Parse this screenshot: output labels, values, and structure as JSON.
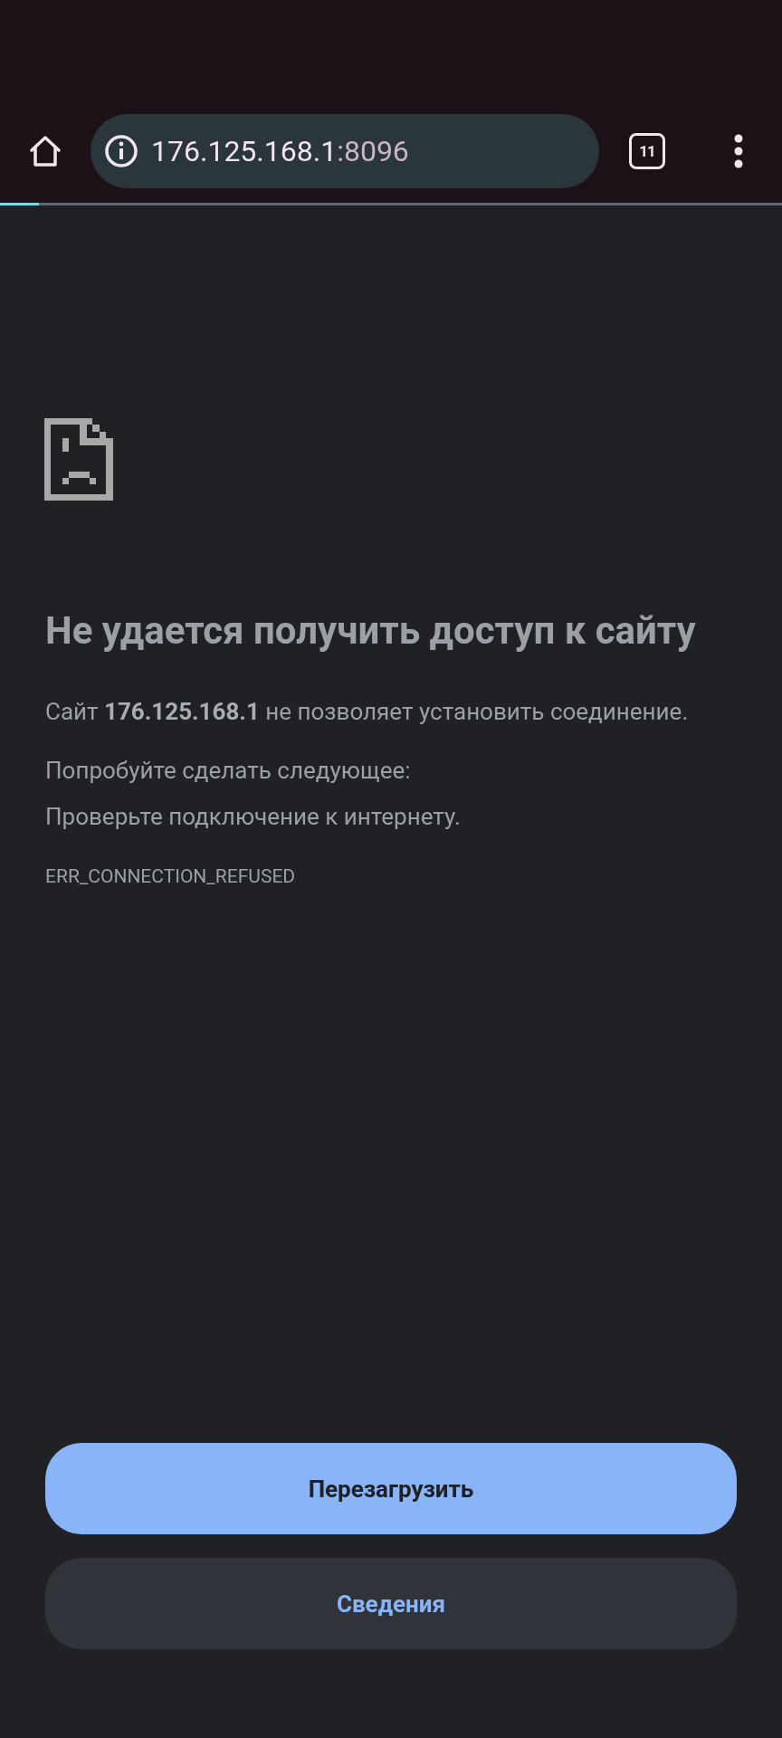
{
  "toolbar": {
    "url_host": "176.125.168.1",
    "url_rest": ":8096",
    "tab_count": "11"
  },
  "progress": {
    "level": 0.05
  },
  "error": {
    "title": "Не удается получить доступ к сайту",
    "message": "Сайт **176.125.168.1** не позволяет установить соединение.",
    "suggestions_heading": "Попробуйте сделать следующее:",
    "suggestions": [
      "Проверьте подключение к интернету."
    ],
    "code": "ERR_CONNECTION_REFUSED"
  },
  "buttons": [
    {
      "label": "Перезагрузить",
      "kind": "primary"
    },
    {
      "label": "Сведения",
      "kind": "secondary"
    }
  ]
}
